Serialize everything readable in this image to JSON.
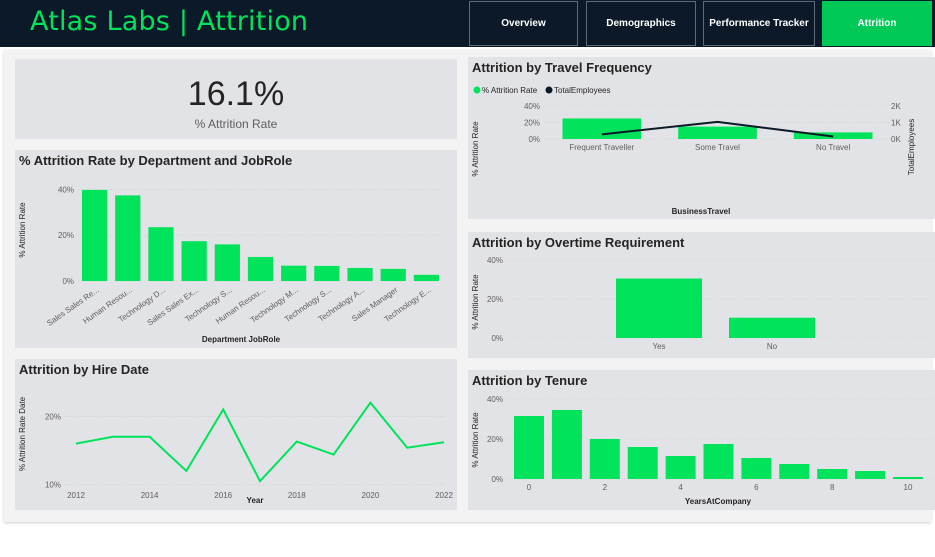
{
  "header": {
    "title": "Atlas Labs | Attrition",
    "tabs": [
      {
        "label": "Overview"
      },
      {
        "label": "Demographics"
      },
      {
        "label": "Performance Tracker"
      },
      {
        "label": "Attrition"
      }
    ]
  },
  "colors": {
    "accent": "#00e35a",
    "dark": "#0b1929",
    "active_tab": "#00c957",
    "line_dark": "#0b1929"
  },
  "kpi": {
    "value": "16.1%",
    "label": "% Attrition Rate"
  },
  "chart_data": [
    {
      "id": "dept",
      "type": "bar",
      "title": "% Attrition Rate by Department and JobRole",
      "xlabel": "Department JobRole",
      "ylabel": "% Attrition Rate",
      "ylim": [
        0,
        45
      ],
      "yticks": [
        0,
        20,
        40
      ],
      "categories": [
        "Sales Sales Re...",
        "Human Resou...",
        "Technology D...",
        "Sales Sales Ex...",
        "Technology S...",
        "Human Resou...",
        "Technology M...",
        "Technology S...",
        "Technology A...",
        "Sales Manager",
        "Technology E..."
      ],
      "values": [
        39.8,
        37.4,
        23.5,
        17.4,
        16.0,
        10.5,
        6.7,
        6.6,
        5.7,
        5.3,
        2.7
      ]
    },
    {
      "id": "hire",
      "type": "line",
      "title": "Attrition by Hire Date",
      "xlabel": "Year",
      "ylabel": "% Attrition Rate Date",
      "ylim": [
        9.5,
        24
      ],
      "yticks": [
        10,
        20
      ],
      "xticks": [
        2012,
        2014,
        2016,
        2018,
        2020,
        2022
      ],
      "x": [
        2012,
        2013,
        2014,
        2015,
        2016,
        2017,
        2018,
        2019,
        2020,
        2021,
        2022
      ],
      "values": [
        16.0,
        17.0,
        17.0,
        12.0,
        21.0,
        10.5,
        16.3,
        14.4,
        22.0,
        15.4,
        16.2
      ]
    },
    {
      "id": "travel",
      "type": "bar",
      "title": "Attrition by Travel Frequency",
      "xlabel": "BusinessTravel",
      "ylabel": "% Attrition Rate",
      "y2label": "TotalEmployees",
      "ylim": [
        0,
        40
      ],
      "yticks": [
        0,
        20,
        40
      ],
      "y2lim": [
        0,
        2000
      ],
      "y2ticks": [
        "0K",
        "1K",
        "2K"
      ],
      "legend": [
        "% Attrition Rate",
        "TotalEmployees"
      ],
      "categories": [
        "Frequent Traveller",
        "Some Travel",
        "No Travel"
      ],
      "series": [
        {
          "name": "% Attrition Rate",
          "values": [
            24.9,
            15.0,
            8.0
          ]
        },
        {
          "name": "TotalEmployees",
          "values": [
            280,
            1040,
            150
          ]
        }
      ]
    },
    {
      "id": "overtime",
      "type": "bar",
      "title": "Attrition by Overtime Requirement",
      "ylabel": "% Attrition Rate",
      "ylim": [
        0,
        40
      ],
      "yticks": [
        0,
        20,
        40
      ],
      "categories": [
        "Yes",
        "No"
      ],
      "values": [
        30.5,
        10.4
      ]
    },
    {
      "id": "tenure",
      "type": "bar",
      "title": "Attrition by Tenure",
      "xlabel": "YearsAtCompany",
      "ylabel": "% Attrition Rate",
      "ylim": [
        0,
        40
      ],
      "yticks": [
        0,
        20,
        40
      ],
      "xticks": [
        0,
        2,
        4,
        6,
        8,
        10
      ],
      "categories": [
        0,
        1,
        2,
        3,
        4,
        5,
        6,
        7,
        8,
        9,
        10
      ],
      "values": [
        31.5,
        34.5,
        20.0,
        16.0,
        11.5,
        17.5,
        10.5,
        7.5,
        5.0,
        4.0,
        1.0
      ]
    }
  ]
}
